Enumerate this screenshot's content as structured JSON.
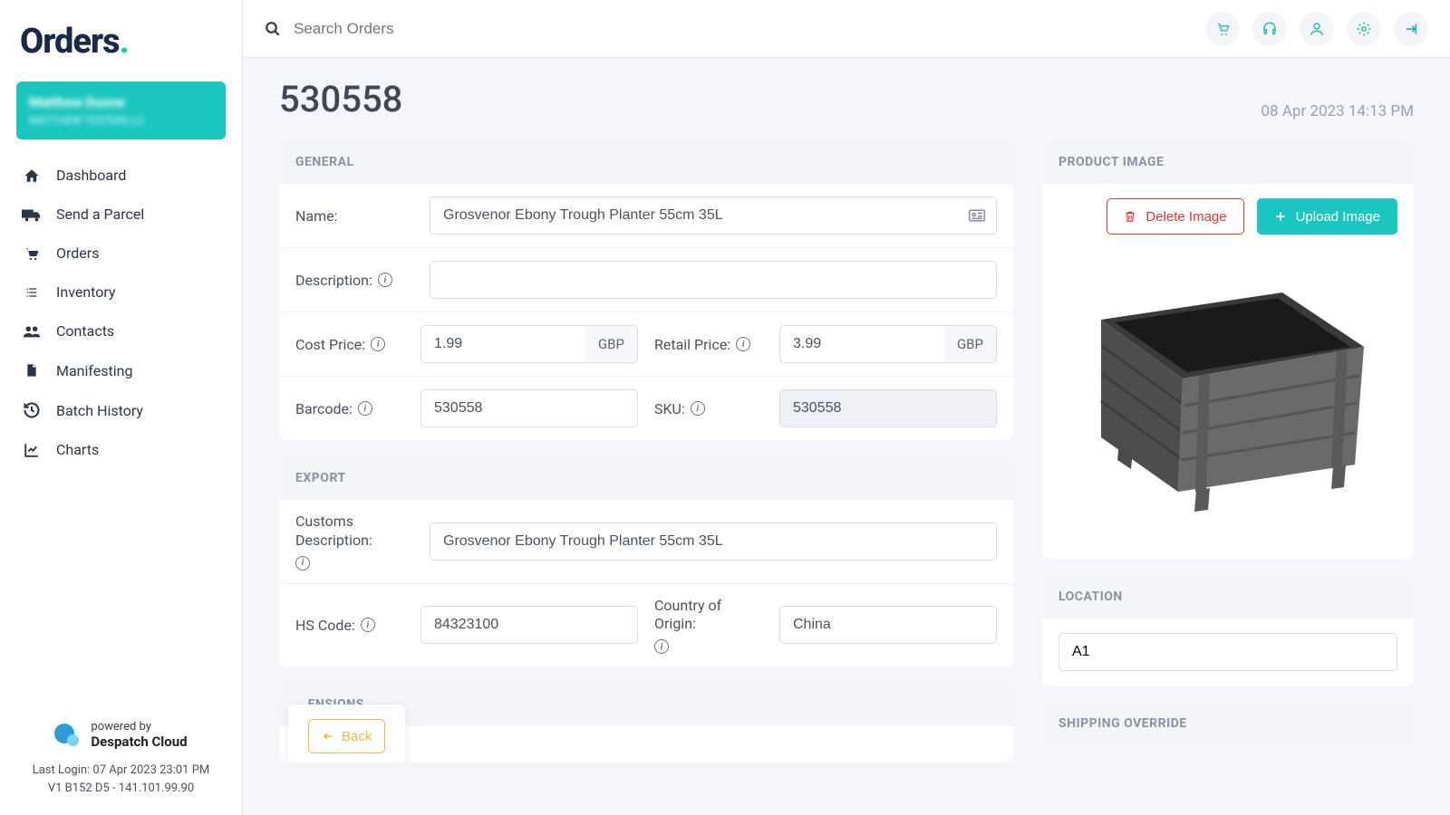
{
  "brand": {
    "name": "Orders",
    "dot": "."
  },
  "user": {
    "name": "Matthew Dunne",
    "sub": "MATTHEW TESTERS LC"
  },
  "nav": [
    {
      "id": "dashboard",
      "label": "Dashboard",
      "icon": "home"
    },
    {
      "id": "send-parcel",
      "label": "Send a Parcel",
      "icon": "truck"
    },
    {
      "id": "orders",
      "label": "Orders",
      "icon": "cart"
    },
    {
      "id": "inventory",
      "label": "Inventory",
      "icon": "list"
    },
    {
      "id": "contacts",
      "label": "Contacts",
      "icon": "users"
    },
    {
      "id": "manifesting",
      "label": "Manifesting",
      "icon": "file"
    },
    {
      "id": "batch-history",
      "label": "Batch History",
      "icon": "history"
    },
    {
      "id": "charts",
      "label": "Charts",
      "icon": "chart"
    }
  ],
  "footer": {
    "powered_label": "powered by",
    "powered_name": "Despatch Cloud",
    "last_login": "Last Login: 07 Apr 2023 23:01 PM",
    "version": "V1 B152 D5 - 141.101.99.90"
  },
  "search": {
    "placeholder": "Search Orders"
  },
  "header": {
    "title": "530558",
    "timestamp": "08 Apr 2023 14:13 PM"
  },
  "general": {
    "section": "GENERAL",
    "name_lbl": "Name:",
    "name": "Grosvenor Ebony Trough Planter 55cm 35L",
    "description_lbl": "Description:",
    "description": "",
    "cost_price_lbl": "Cost Price:",
    "cost_price": "1.99",
    "retail_price_lbl": "Retail Price:",
    "retail_price": "3.99",
    "currency": "GBP",
    "barcode_lbl": "Barcode:",
    "barcode": "530558",
    "sku_lbl": "SKU:",
    "sku": "530558"
  },
  "export": {
    "section": "EXPORT",
    "customs_lbl": "Customs Description:",
    "customs": "Grosvenor Ebony Trough Planter 55cm 35L",
    "hs_lbl": "HS Code:",
    "hs": "84323100",
    "coo_lbl": "Country of Origin:",
    "coo": "China"
  },
  "dimensions": {
    "section": "...ENSIONS"
  },
  "product_image": {
    "section": "PRODUCT IMAGE",
    "delete": "Delete Image",
    "upload": "Upload Image"
  },
  "location": {
    "section": "LOCATION",
    "value": "A1"
  },
  "shipping": {
    "section": "SHIPPING OVERRIDE"
  },
  "back": "Back"
}
